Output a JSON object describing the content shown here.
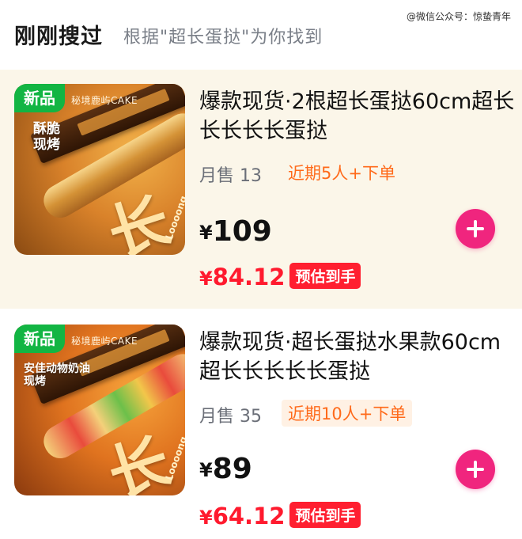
{
  "header": {
    "title": "刚刚搜过",
    "subtitle": "根据\"超长蛋挞\"为你找到",
    "watermark": "@微信公众号：惊蛰青年"
  },
  "products": [
    {
      "badge": "新品",
      "brand": "秘境鹿屿CAKE",
      "promo_lines": [
        "酥脆",
        "现烤"
      ],
      "image_big_char": "长",
      "image_small_text": "Loooong",
      "name": "爆款现货·2根超长蛋挞60cm超长长长长长蛋挞",
      "sales": "月售 13",
      "recent": "近期5人+下单",
      "currency": "¥",
      "price": "109",
      "est_price": "84.12",
      "est_tag": "预估到手",
      "add_icon": "plus-icon"
    },
    {
      "badge": "新品",
      "brand": "秘境鹿屿CAKE",
      "promo_lines": [
        "安佳动物奶油",
        "现烤"
      ],
      "image_big_char": "长",
      "image_small_text": "Loooong",
      "name": "爆款现货·超长蛋挞水果款60cm超长长长长长蛋挞",
      "sales": "月售 35",
      "recent": "近期10人+下单",
      "currency": "¥",
      "price": "89",
      "est_price": "64.12",
      "est_tag": "预估到手",
      "add_icon": "plus-icon"
    }
  ]
}
